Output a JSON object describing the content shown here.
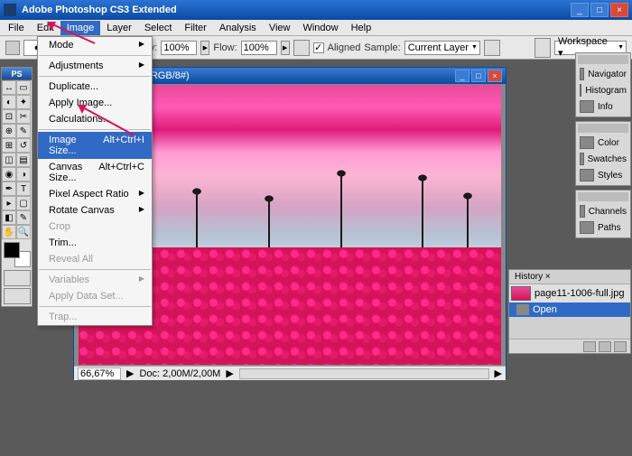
{
  "app": {
    "title": "Adobe Photoshop CS3 Extended"
  },
  "menubar": {
    "items": [
      "File",
      "Edit",
      "Image",
      "Layer",
      "Select",
      "Filter",
      "Analysis",
      "View",
      "Window",
      "Help"
    ],
    "active_index": 2
  },
  "optionsbar": {
    "opacity_label": "Opacity:",
    "opacity_value": "100%",
    "flow_label": "Flow:",
    "flow_value": "100%",
    "aligned_checked": "✓",
    "aligned_label": "Aligned",
    "sample_label": "Sample:",
    "sample_value": "Current Layer",
    "workspace_label": "Workspace ▾"
  },
  "dropdown": {
    "groups": [
      [
        {
          "label": "Mode",
          "submenu": true
        }
      ],
      [
        {
          "label": "Adjustments",
          "submenu": true
        }
      ],
      [
        {
          "label": "Duplicate..."
        },
        {
          "label": "Apply Image..."
        },
        {
          "label": "Calculations..."
        }
      ],
      [
        {
          "label": "Image Size...",
          "shortcut": "Alt+Ctrl+I",
          "highlighted": true
        },
        {
          "label": "Canvas Size...",
          "shortcut": "Alt+Ctrl+C"
        },
        {
          "label": "Pixel Aspect Ratio",
          "submenu": true
        },
        {
          "label": "Rotate Canvas",
          "submenu": true
        },
        {
          "label": "Crop",
          "disabled": true
        },
        {
          "label": "Trim..."
        },
        {
          "label": "Reveal All",
          "disabled": true
        }
      ],
      [
        {
          "label": "Variables",
          "submenu": true,
          "disabled": true
        },
        {
          "label": "Apply Data Set...",
          "disabled": true
        }
      ],
      [
        {
          "label": "Trap...",
          "disabled": true
        }
      ]
    ]
  },
  "toolbox": {
    "ps_label": "PS"
  },
  "document": {
    "title": ".ll.jpg @ 66,7% (RGB/8#)",
    "zoom": "66,67%",
    "doc_info": "Doc: 2,00M/2,00M"
  },
  "panels": {
    "right": [
      [
        "Navigator",
        "Histogram",
        "Info"
      ],
      [
        "Color",
        "Swatches",
        "Styles"
      ],
      [
        "Channels",
        "Paths"
      ]
    ]
  },
  "history": {
    "tab": "History ×",
    "file_row": "page11-1006-full.jpg",
    "open_row": "Open"
  }
}
